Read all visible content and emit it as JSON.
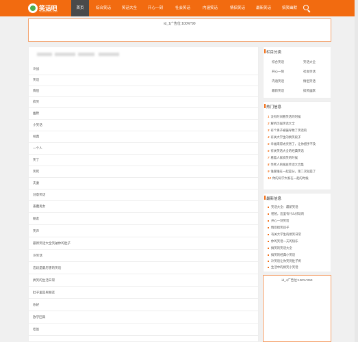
{
  "logo": {
    "name": "笑话吧",
    "url": "TGSUXXX.COM"
  },
  "nav": [
    {
      "label": "首页",
      "active": true
    },
    {
      "label": "综合笑话"
    },
    {
      "label": "笑话大全"
    },
    {
      "label": "开心一刻"
    },
    {
      "label": "社会笑话"
    },
    {
      "label": "内涵笑话"
    },
    {
      "label": "情侣笑话"
    },
    {
      "label": "最新笑话"
    },
    {
      "label": "搞笑幽默"
    }
  ],
  "ads": {
    "top": "id_1广告位:100%*90",
    "side": "id_4广告位:100%*250"
  },
  "main": {
    "items": [
      "冷战",
      "笑话",
      "情侣",
      "搞笑",
      "幽默",
      "小笑话",
      "经典",
      "一个人",
      "笑了",
      "笑死",
      "夫妻",
      "创意笑话",
      "愚蠢男女",
      "朋友",
      "笑声",
      "最新笑话大全笑破你的肚子",
      "冷笑话",
      "这段是最厉害的笑话",
      "搞笑的生活日常",
      "肚子里是男朋友",
      "你好",
      "放学回来",
      "吃饭"
    ]
  },
  "sidebar": {
    "categories_title": "栏目分类",
    "categories": [
      "综合笑话",
      "笑话大全",
      "开心一刻",
      "社会笑话",
      "内涵笑话",
      "情侣笑话",
      "最新笑话",
      "搞笑幽默"
    ],
    "hot_title": "热门信息",
    "hot": [
      "没有时间看笑话的时候",
      "解析历届笑话大全",
      "有个男子被骗导致了笑话的",
      "有关大学生的搞笑段子",
      "幸福来得太突然了，让你措手不及",
      "有关笑话大全的经典笑话",
      "看着人家搞笑的时候",
      "笑死人的家庭笑话大合集",
      "谁跟谁在一起是分，第二次就是了",
      "你的同学大家在一起的时候"
    ],
    "latest_title": "最新信息",
    "latest": [
      "笑话大全：最新笑话",
      "爸爸，这里有什么好玩的",
      "开心一刻笑话",
      "情侣搞笑段子",
      "有关大学生的搞笑日常",
      "你的笑话一天的快乐",
      "搞笑的笑话大全",
      "搞笑的经典小笑话",
      "冷笑话让你笑到肚子疼",
      "生活中的搞笑小笑话"
    ]
  },
  "colors": {
    "brand": "#f26b10",
    "active_nav": "#4a4a4a"
  }
}
